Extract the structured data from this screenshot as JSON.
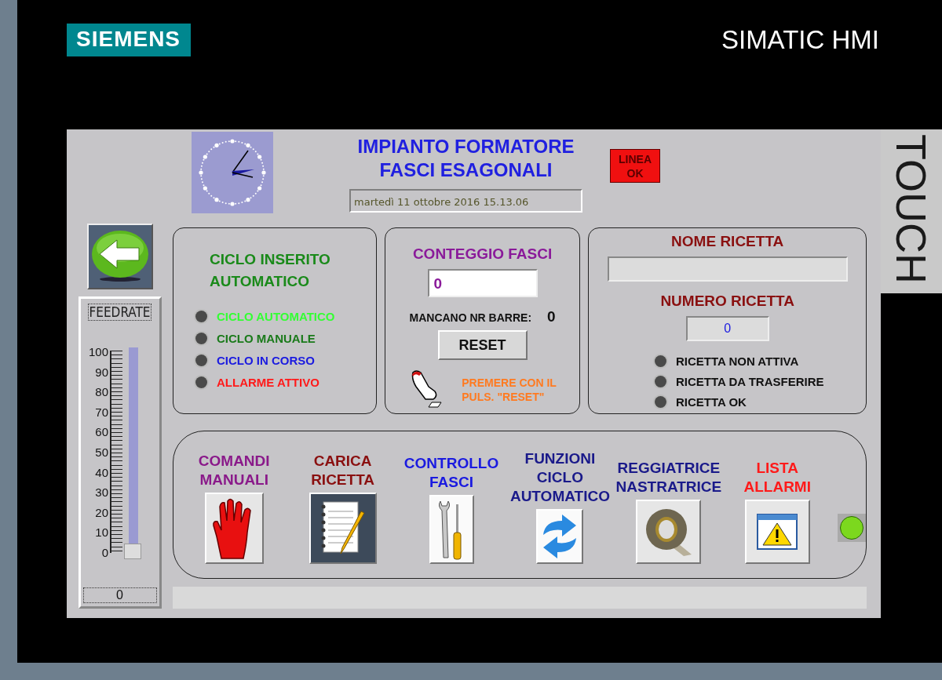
{
  "device": {
    "brand": "SIEMENS",
    "product": "SIMATIC HMI",
    "side_label": "TOUCH"
  },
  "header": {
    "title_lines": [
      "IMPIANTO FORMATORE",
      "FASCI ESAGONALI"
    ],
    "datetime": "martedì 11 ottobre 2016 15.13.06",
    "line_status": {
      "label_lines": [
        "LINEA",
        "OK"
      ]
    }
  },
  "feedrate": {
    "label": "FEEDRATE",
    "scale": [
      "100",
      "90",
      "80",
      "70",
      "60",
      "50",
      "40",
      "30",
      "20",
      "10",
      "0"
    ],
    "level": 0,
    "value": "0"
  },
  "cycle_panel": {
    "title_lines": [
      "CICLO INSERITO",
      "AUTOMATICO"
    ],
    "indicators": [
      {
        "label": "CICLO AUTOMATICO",
        "color": "#33ff33",
        "on": false
      },
      {
        "label": "CICLO MANUALE",
        "color": "#1a7a1a",
        "on": false
      },
      {
        "label": "CICLO IN CORSO",
        "color": "#1a1ae0",
        "on": false
      },
      {
        "label": "ALLARME ATTIVO",
        "color": "#ff1a1a",
        "on": false
      }
    ]
  },
  "count_panel": {
    "title": "CONTEGGIO FASCI",
    "count": "0",
    "missing_label": "MANCANO NR BARRE:",
    "missing_value": "0",
    "reset_button": "RESET",
    "hint_lines": [
      "PREMERE CON IL",
      "PULS. \"RESET\""
    ]
  },
  "recipe_panel": {
    "name_title": "NOME RICETTA",
    "number_title": "NUMERO RICETTA",
    "number_value": "0",
    "indicators": [
      {
        "label": "RICETTA NON ATTIVA",
        "on": false
      },
      {
        "label": "RICETTA DA TRASFERIRE",
        "on": false
      },
      {
        "label": "RICETTA OK",
        "on": false
      }
    ]
  },
  "functions": [
    {
      "label_lines": [
        "COMANDI",
        "MANUALI"
      ],
      "color": "#8a1a8a",
      "kind": "hand"
    },
    {
      "label_lines": [
        "CARICA",
        "RICETTA"
      ],
      "color": "#8a1010",
      "kind": "notepad"
    },
    {
      "label_lines": [
        "CONTROLLO",
        "FASCI"
      ],
      "color": "#1a1ae0",
      "kind": "tools"
    },
    {
      "label_lines": [
        "FUNZIONI",
        "CICLO",
        "AUTOMATICO"
      ],
      "color": "#1a1a8a",
      "kind": "refresh"
    },
    {
      "label_lines": [
        "REGGIATRICE",
        "NASTRATRICE"
      ],
      "color": "#1a1a8a",
      "kind": "tape"
    },
    {
      "label_lines": [
        "LISTA",
        "ALLARMI"
      ],
      "color": "#ff1a1a",
      "kind": "alarm"
    }
  ],
  "status_lamp": {
    "on": true
  }
}
